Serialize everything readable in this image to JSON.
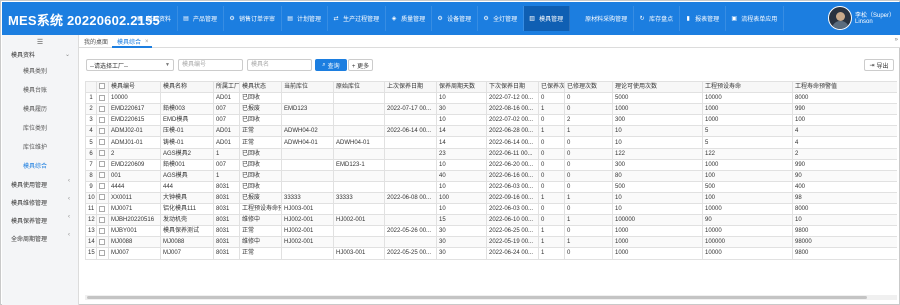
{
  "app_title": "MES系统 20220602.2155",
  "nav": [
    {
      "label": "基础资料",
      "icon": "grid-icon"
    },
    {
      "label": "产品管理",
      "icon": "document-icon"
    },
    {
      "label": "销售订单评审",
      "icon": "settings-icon"
    },
    {
      "label": "计划管理",
      "icon": "document-icon"
    },
    {
      "label": "生产过程管理",
      "icon": "transfer-icon"
    },
    {
      "label": "质量管理",
      "icon": "badge-icon"
    },
    {
      "label": "设备管理",
      "icon": "gear-icon"
    },
    {
      "label": "全灯管理",
      "icon": "settings-icon"
    },
    {
      "label": "模具管理",
      "icon": "stack-icon"
    },
    {
      "label": "原材料采购管理",
      "icon": "none"
    },
    {
      "label": "库存盘点",
      "icon": "refresh-icon"
    },
    {
      "label": "报表管理",
      "icon": "bar-chart-icon"
    },
    {
      "label": "流程表单应用",
      "icon": "form-icon"
    }
  ],
  "nav_active_index": 8,
  "user": {
    "name": "李松（Super）",
    "account": "Linson"
  },
  "sidebar": {
    "group_main": "模具资料",
    "items": [
      "模具类别",
      "模具台账",
      "模具履历",
      "库位类别",
      "库位维护",
      "模具综合"
    ],
    "active_item": 5,
    "groups": [
      "模具使用管理",
      "模具维修管理",
      "模具保养管理",
      "全命周期管理"
    ]
  },
  "tabs": {
    "home": "我的桌面",
    "current": "模具综合"
  },
  "filter": {
    "factory_select": "--请选择工厂--",
    "code_placeholder": "模具编号",
    "name_placeholder": "模具名",
    "search_label": "查询",
    "more_label": "+ 更多",
    "export_label": "导出"
  },
  "table": {
    "columns": [
      "",
      "模具编号",
      "模具名称",
      "所属工厂",
      "模具状态",
      "当前库位",
      "原始库位",
      "上次保养日期",
      "保养周期天数",
      "下次保养日期",
      "已保养次数",
      "已修理次数",
      "理论可使用次数",
      "工程预设寿命",
      "工程寿命预警值"
    ],
    "rows": [
      [
        "1",
        "10000",
        "",
        "AD01",
        "已回收",
        "",
        "",
        "",
        "10",
        "2022-07-12 00...",
        "0",
        "0",
        "5000",
        "10000",
        "8000"
      ],
      [
        "2",
        "EMD220617",
        "鉛模003",
        "007",
        "已报废",
        "EMD123",
        "",
        "2022-07-17 00...",
        "30",
        "2022-08-16 00...",
        "1",
        "0",
        "1000",
        "1000",
        "990"
      ],
      [
        "3",
        "EMD220615",
        "EMD模具",
        "007",
        "已回收",
        "",
        "",
        "",
        "10",
        "2022-07-02 00...",
        "0",
        "2",
        "300",
        "1000",
        "100"
      ],
      [
        "4",
        "ADMJ02-01",
        "压模-01",
        "AD01",
        "正常",
        "ADWH04-02",
        "",
        "2022-06-14 00...",
        "14",
        "2022-06-28 00...",
        "1",
        "1",
        "10",
        "5",
        "4"
      ],
      [
        "5",
        "ADMJ01-01",
        "铸模-01",
        "AD01",
        "正常",
        "ADWH04-01",
        "ADWH04-01",
        "",
        "14",
        "2022-06-14 00...",
        "0",
        "0",
        "10",
        "5",
        "4"
      ],
      [
        "6",
        "2",
        "AGS模具2",
        "1",
        "已回收",
        "",
        "",
        "",
        "23",
        "2022-06-11 00...",
        "0",
        "0",
        "122",
        "122",
        "2"
      ],
      [
        "7",
        "EMD220609",
        "鉛模001",
        "007",
        "已回收",
        "",
        "EMD123-1",
        "",
        "10",
        "2022-06-20 00...",
        "0",
        "0",
        "300",
        "1000",
        "990"
      ],
      [
        "8",
        "001",
        "AGS模具",
        "1",
        "已回收",
        "",
        "",
        "",
        "40",
        "2022-06-16 00...",
        "0",
        "0",
        "80",
        "100",
        "90"
      ],
      [
        "9",
        "4444",
        "444",
        "8031",
        "已回收",
        "",
        "",
        "",
        "10",
        "2022-06-03 00...",
        "0",
        "0",
        "500",
        "500",
        "400"
      ],
      [
        "10",
        "XX0011",
        "大钟模具",
        "8031",
        "已报废",
        "33333",
        "33333",
        "2022-06-08 00...",
        "100",
        "2022-09-16 00...",
        "1",
        "1",
        "10",
        "100",
        "98"
      ],
      [
        "11",
        "MJ0071",
        "铝化模具111",
        "8031",
        "工程预设寿命预警",
        "HJ003-001",
        "",
        "",
        "10",
        "2022-06-03 00...",
        "0",
        "0",
        "10",
        "10000",
        "8000"
      ],
      [
        "12",
        "MJBH20220516",
        "发动机壳",
        "8031",
        "维修中",
        "HJ002-001",
        "HJ002-001",
        "",
        "15",
        "2022-06-10 00...",
        "0",
        "1",
        "100000",
        "90",
        "10"
      ],
      [
        "13",
        "MJBY001",
        "模具保养测试",
        "8031",
        "正常",
        "HJ002-001",
        "",
        "2022-05-26 00...",
        "30",
        "2022-06-25 00...",
        "1",
        "0",
        "1000",
        "10000",
        "9800"
      ],
      [
        "14",
        "MJ0088",
        "MJ0088",
        "8031",
        "维修中",
        "HJ002-001",
        "",
        "",
        "30",
        "2022-05-19 00...",
        "1",
        "1",
        "1000",
        "100000",
        "98000"
      ],
      [
        "15",
        "MJ007",
        "MJ007",
        "8031",
        "正常",
        "",
        "HJ003-001",
        "2022-05-25 00...",
        "30",
        "2022-06-24 00...",
        "1",
        "0",
        "1000",
        "10000",
        "9800"
      ]
    ]
  }
}
